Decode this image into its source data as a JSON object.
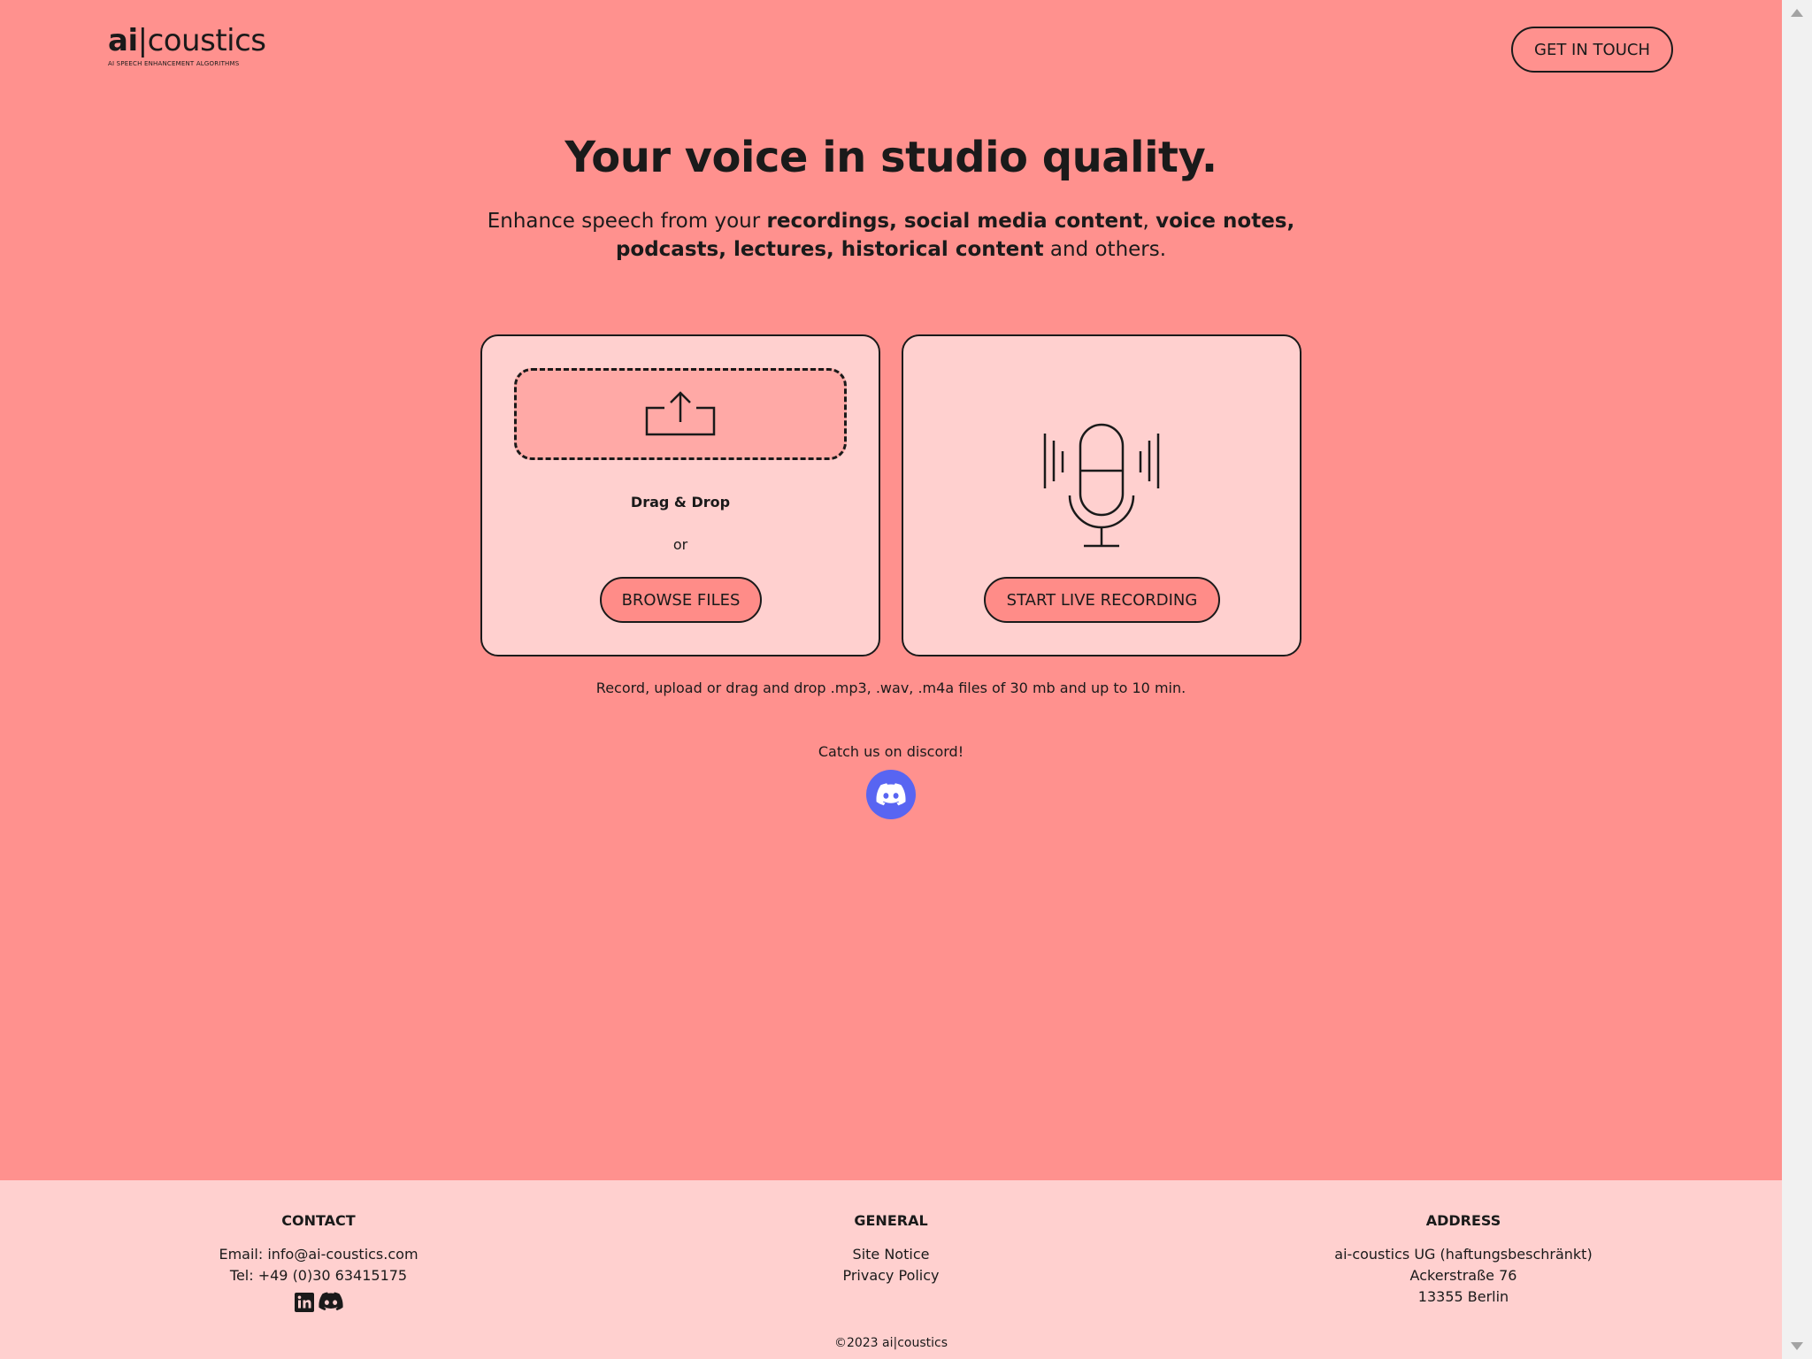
{
  "header": {
    "logo_ai": "ai",
    "logo_rest": "|coustics",
    "logo_tagline": "AI SPEECH ENHANCEMENT ALGORITHMS",
    "cta_label": "GET IN TOUCH"
  },
  "hero": {
    "title": "Your voice in studio quality.",
    "sub_intro": "Enhance speech from your ",
    "sub_b1": "recordings, social media content",
    "sub_c1": ", ",
    "sub_b2": "voice notes, podcasts, lectures, historical content",
    "sub_outro": " and others."
  },
  "upload_card": {
    "drag_label": "Drag & Drop",
    "or_label": "or",
    "browse_label": "BROWSE FILES"
  },
  "record_card": {
    "record_label": "START LIVE RECORDING"
  },
  "info": {
    "formats_text": "Record, upload or drag and drop .mp3, .wav, .m4a files of 30 mb and up to 10 min.",
    "discord_text": "Catch us on discord!"
  },
  "footer": {
    "contact": {
      "heading": "CONTACT",
      "email": "Email: info@ai-coustics.com",
      "tel": "Tel: +49 (0)30 63415175"
    },
    "general": {
      "heading": "GENERAL",
      "site_notice": "Site Notice",
      "privacy": "Privacy Policy"
    },
    "address": {
      "heading": "ADDRESS",
      "line1": "ai-coustics UG (haftungsbeschränkt)",
      "line2": "Ackerstraße 76",
      "line3": "13355 Berlin"
    },
    "copyright": "©2023 ai|coustics"
  },
  "colors": {
    "background": "#FF918E",
    "card": "#FFD0CF",
    "dropzone": "#FFA9A6",
    "button_fill": "#FF8C88",
    "footer": "#FFD0CF",
    "discord": "#5865F2",
    "text": "#1a1a1a"
  },
  "icons": [
    "upload-icon",
    "microphone-icon",
    "discord-icon",
    "linkedin-icon"
  ]
}
